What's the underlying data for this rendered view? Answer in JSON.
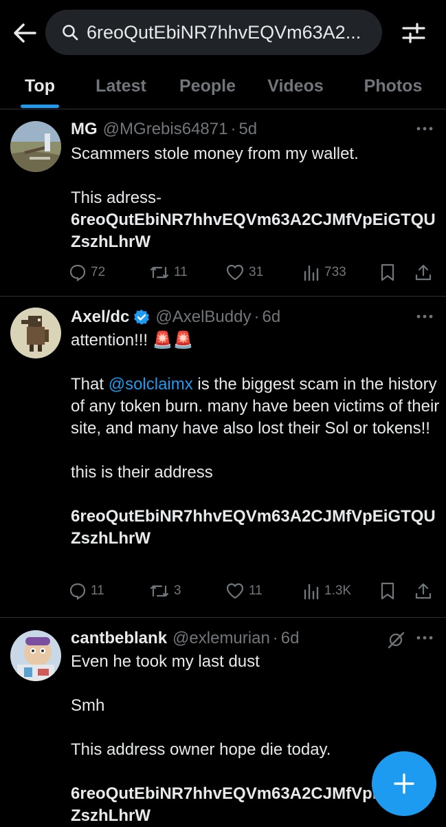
{
  "search": {
    "query": "6reoQutEbiNR7hhvEQVm63A2..."
  },
  "tabs": [
    {
      "label": "Top",
      "active": true
    },
    {
      "label": "Latest"
    },
    {
      "label": "People"
    },
    {
      "label": "Videos"
    },
    {
      "label": "Photos"
    }
  ],
  "posts": [
    {
      "name": "MG",
      "handle": "@MGrebis64871",
      "dot": "·",
      "time": "5d",
      "line1": "Scammers stole money from my wallet.",
      "line2": "This adress-",
      "address": "6reoQutEbiNR7hhvEQVm63A2CJMfVpEiGTQUZszhLhrW",
      "replies": "72",
      "reposts": "11",
      "likes": "31",
      "views": "733"
    },
    {
      "name": "Axel/dc",
      "handle": "@AxelBuddy",
      "dot": "·",
      "time": "6d",
      "line1": "attention!!! 🚨🚨",
      "mention": "@solclaimx",
      "line2_rest": " is the biggest scam in the history of any token burn. many have been victims of their site, and many have also lost their Sol or tokens!!",
      "line2_prefix": "That ",
      "line3": "this is their address",
      "address": "6reoQutEbiNR7hhvEQVm63A2CJMfVpEiGTQUZszhLhrW",
      "replies": "11",
      "reposts": "3",
      "likes": "11",
      "views": "1.3K"
    },
    {
      "name": "cantbeblank",
      "handle": "@exlemurian",
      "dot": "·",
      "time": "6d",
      "line1": "Even he took my last dust",
      "line2": "Smh",
      "line3": "This address owner hope die today.",
      "address": "6reoQutEbiNR7hhvEQVm63A2CJMfVpEiGTQUZszhLhrW"
    }
  ],
  "colors": {
    "accent": "#1d9bf0",
    "muted": "#71767b",
    "background": "#000000"
  }
}
